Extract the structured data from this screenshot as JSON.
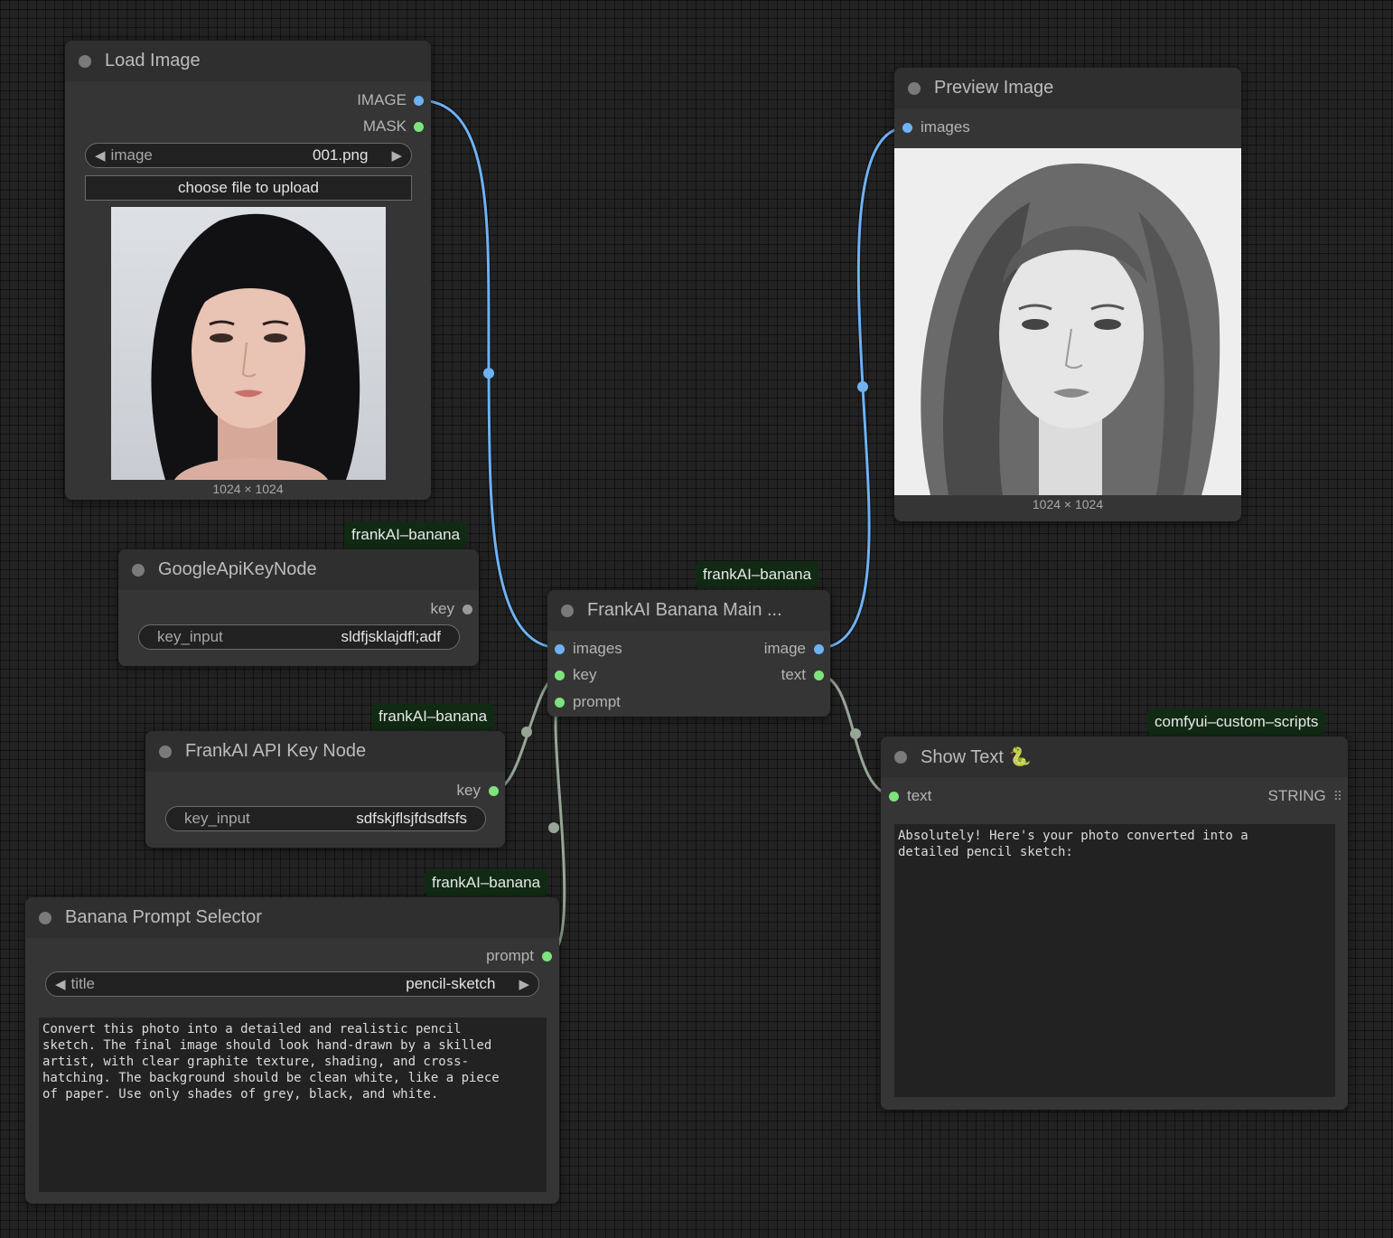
{
  "colors": {
    "canvas": "#222222",
    "node_bg": "#353535",
    "image_slot": "#6eb2f3",
    "string_slot": "#7ee37d",
    "badge_bg": "#112a14"
  },
  "load_image": {
    "title": "Load Image",
    "outputs": [
      "IMAGE",
      "MASK"
    ],
    "image_widget": {
      "label": "image",
      "value": "001.png"
    },
    "upload_label": "choose file to upload",
    "dimensions": "1024 × 1024"
  },
  "preview_image": {
    "title": "Preview Image",
    "input": "images",
    "dimensions": "1024 × 1024"
  },
  "google_api_key": {
    "badge": "frankAI–banana",
    "title": "GoogleApiKeyNode",
    "output": "key",
    "key_widget": {
      "label": "key_input",
      "value": "sldfjsklajdfl;adf"
    }
  },
  "banana_main": {
    "badge": "frankAI–banana",
    "title": "FrankAI Banana Main ...",
    "inputs": [
      "images",
      "key",
      "prompt"
    ],
    "outputs": [
      "image",
      "text"
    ]
  },
  "frankai_api_key": {
    "badge": "frankAI–banana",
    "title": "FrankAI API Key Node",
    "output": "key",
    "key_widget": {
      "label": "key_input",
      "value": "sdfskjflsjfdsdfsfs"
    }
  },
  "show_text": {
    "badge": "comfyui–custom–scripts",
    "title": "Show Text 🐍",
    "input": "text",
    "output_type": "STRING",
    "content": "Absolutely! Here's your photo converted into a\ndetailed pencil sketch:"
  },
  "prompt_selector": {
    "badge": "frankAI–banana",
    "title": "Banana Prompt Selector",
    "output": "prompt",
    "title_widget": {
      "label": "title",
      "value": "pencil-sketch"
    },
    "prompt_text": "Convert this photo into a detailed and realistic pencil\nsketch. The final image should look hand-drawn by a skilled\nartist, with clear graphite texture, shading, and cross-\nhatching. The background should be clean white, like a piece\nof paper. Use only shades of grey, black, and white."
  }
}
